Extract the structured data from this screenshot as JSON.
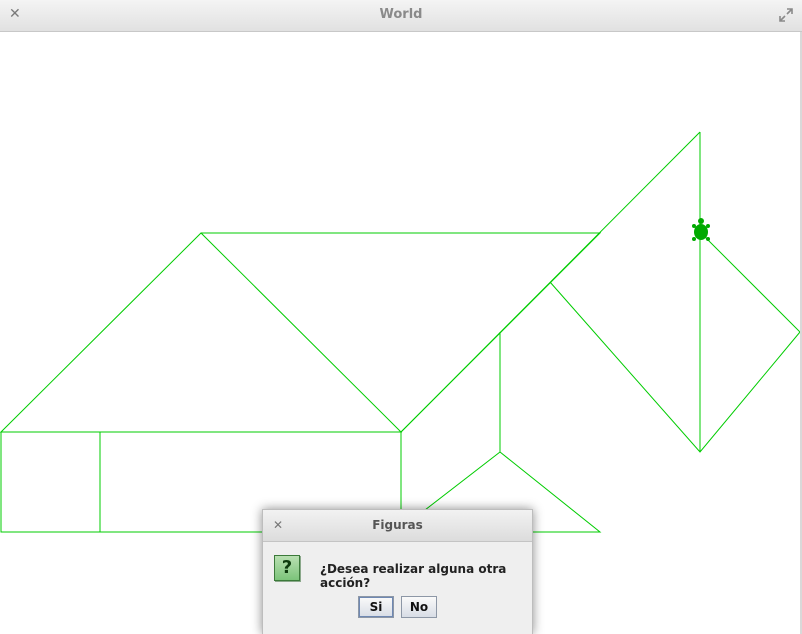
{
  "window": {
    "title": "World",
    "close_icon": "close-icon",
    "maximize_icon": "maximize-icon"
  },
  "colors": {
    "stroke": "#00cc00",
    "turtle": "#00aa00"
  },
  "dialog": {
    "title": "Figuras",
    "icon": "question-icon",
    "icon_glyph": "?",
    "message": "¿Desea realizar alguna otra acción?",
    "buttons": {
      "yes": "Si",
      "no": "No"
    }
  }
}
